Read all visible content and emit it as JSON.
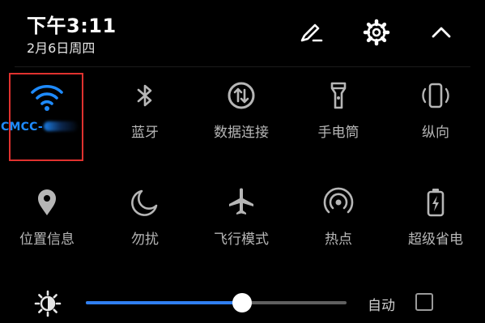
{
  "status": {
    "time": "下午3:11",
    "date": "2月6日周四"
  },
  "header_icons": [
    "edit-icon",
    "settings-gear-icon",
    "chevron-up-icon"
  ],
  "tiles_row1": [
    {
      "name": "wifi",
      "label": "CMCC-",
      "active": true,
      "icon": "wifi-icon"
    },
    {
      "name": "bluetooth",
      "label": "蓝牙",
      "active": false,
      "icon": "bluetooth-icon"
    },
    {
      "name": "mobile-data",
      "label": "数据连接",
      "active": false,
      "icon": "data-transfer-icon"
    },
    {
      "name": "flashlight",
      "label": "手电筒",
      "active": false,
      "icon": "flashlight-icon"
    },
    {
      "name": "auto-rotate",
      "label": "纵向",
      "active": false,
      "icon": "portrait-rotation-icon"
    }
  ],
  "tiles_row2": [
    {
      "name": "location",
      "label": "位置信息",
      "active": false,
      "icon": "location-pin-icon"
    },
    {
      "name": "do-not-disturb",
      "label": "勿扰",
      "active": false,
      "icon": "moon-icon"
    },
    {
      "name": "airplane-mode",
      "label": "飞行模式",
      "active": false,
      "icon": "airplane-icon"
    },
    {
      "name": "hotspot",
      "label": "热点",
      "active": false,
      "icon": "hotspot-icon"
    },
    {
      "name": "power-saver",
      "label": "超级省电",
      "active": false,
      "icon": "battery-saver-icon"
    }
  ],
  "brightness": {
    "level": 0.6,
    "auto_label": "自动",
    "auto_checked": false
  },
  "colors": {
    "accent": "#1e8bff",
    "slider_fill": "#2f7ff0",
    "highlight_border": "#e0322f",
    "icon_inactive": "#b6b6b6"
  }
}
